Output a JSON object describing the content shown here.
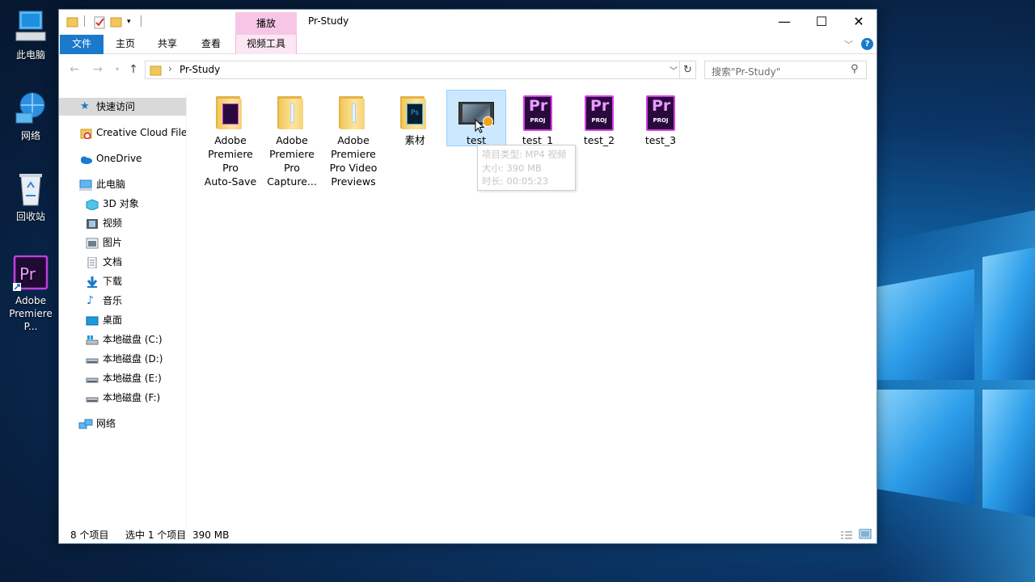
{
  "desktop": {
    "icons": [
      {
        "label": "此电脑",
        "icon": "this-pc-icon"
      },
      {
        "label": "网络",
        "icon": "network-icon"
      },
      {
        "label": "回收站",
        "icon": "recycle-bin-icon"
      },
      {
        "label_line1": "Adobe",
        "label_line2": "Premiere P...",
        "icon": "premiere-pro-icon"
      }
    ]
  },
  "window": {
    "title": "Pr-Study",
    "context_tab_group": "播放",
    "controls": {
      "minimize": "—",
      "maximize": "☐",
      "close": "✕"
    }
  },
  "ribbon": {
    "tabs": [
      "文件",
      "主页",
      "共享",
      "查看",
      "视频工具"
    ]
  },
  "address": {
    "path": "Pr-Study",
    "search_placeholder": "搜索\"Pr-Study\""
  },
  "navpane": {
    "items": [
      {
        "label": "快速访问",
        "icon": "star-icon"
      },
      {
        "label": "Creative Cloud Files",
        "icon": "creative-cloud-icon"
      },
      {
        "label": "OneDrive",
        "icon": "onedrive-icon"
      },
      {
        "label": "此电脑",
        "icon": "this-pc-icon"
      },
      {
        "label": "3D 对象",
        "icon": "3d-objects-icon"
      },
      {
        "label": "视频",
        "icon": "videos-icon"
      },
      {
        "label": "图片",
        "icon": "pictures-icon"
      },
      {
        "label": "文档",
        "icon": "documents-icon"
      },
      {
        "label": "下载",
        "icon": "downloads-icon"
      },
      {
        "label": "音乐",
        "icon": "music-icon"
      },
      {
        "label": "桌面",
        "icon": "desktop-icon"
      },
      {
        "label": "本地磁盘 (C:)",
        "icon": "drive-c-icon"
      },
      {
        "label": "本地磁盘 (D:)",
        "icon": "drive-icon"
      },
      {
        "label": "本地磁盘 (E:)",
        "icon": "drive-icon"
      },
      {
        "label": "本地磁盘 (F:)",
        "icon": "drive-icon"
      },
      {
        "label": "网络",
        "icon": "network-icon"
      }
    ]
  },
  "files": [
    {
      "l1": "Adobe",
      "l2": "Premiere",
      "l3": "Pro",
      "l4": "Auto-Save",
      "type": "folder-premiere"
    },
    {
      "l1": "Adobe",
      "l2": "Premiere",
      "l3": "Pro",
      "l4": "Capture...",
      "type": "folder"
    },
    {
      "l1": "Adobe",
      "l2": "Premiere",
      "l3": "Pro Video",
      "l4": "Previews",
      "type": "folder"
    },
    {
      "l1": "素材",
      "type": "folder-photoshop"
    },
    {
      "l1": "test",
      "type": "mp4-video"
    },
    {
      "l1": "test_1",
      "type": "prproj"
    },
    {
      "l1": "test_2",
      "type": "prproj"
    },
    {
      "l1": "test_3",
      "type": "prproj"
    }
  ],
  "tooltip": {
    "line1": "项目类型: MP4 视频",
    "line2": "大小: 390 MB",
    "line3": "时长: 00:05:23"
  },
  "status": {
    "count": "8 个项目",
    "selected": "选中 1 个项目",
    "size": "390 MB"
  },
  "colors": {
    "file_tab": "#1979ca",
    "context_tab": "#f7c6e6",
    "selection": "#cce8ff"
  }
}
